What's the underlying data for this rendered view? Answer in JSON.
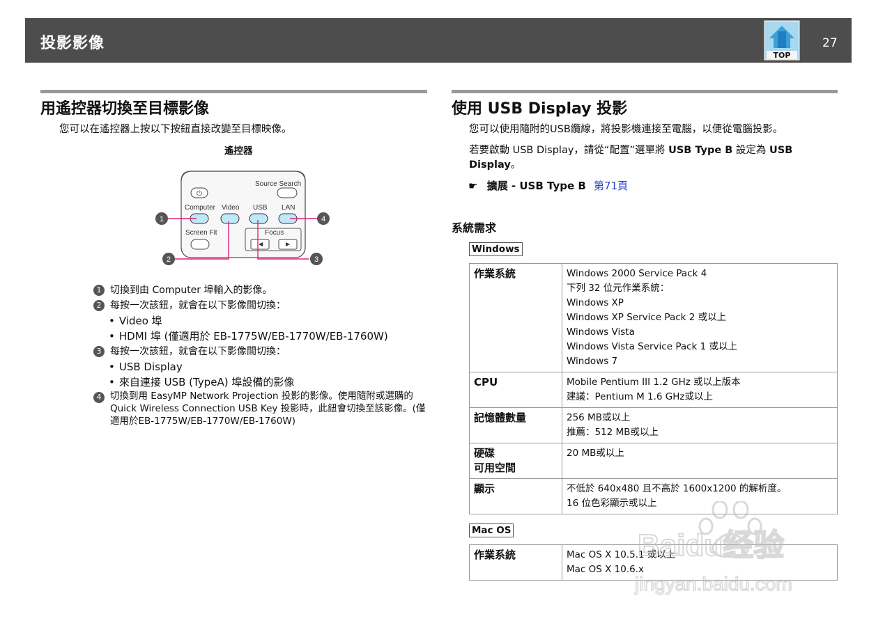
{
  "header": {
    "title": "投影影像",
    "page_number": "27",
    "top_label": "TOP"
  },
  "left": {
    "heading": "用遙控器切換至目標影像",
    "intro": "您可以在遙控器上按以下按鈕直接改變至目標映像。",
    "figure_title": "遙控器",
    "remote": {
      "source_search": "Source Search",
      "computer": "Computer",
      "video": "Video",
      "usb": "USB",
      "lan": "LAN",
      "screen_fit": "Screen Fit",
      "focus": "Focus",
      "callouts": [
        "1",
        "2",
        "3",
        "4"
      ]
    },
    "items": [
      {
        "num": "1",
        "text": "切換到由 Computer 埠輸入的影像。"
      },
      {
        "num": "2",
        "text": "每按一次該鈕，就會在以下影像間切換：",
        "bullets": [
          "Video 埠",
          "HDMI 埠 (僅適用於 EB-1775W/EB-1770W/EB-1760W)"
        ]
      },
      {
        "num": "3",
        "text": "每按一次該鈕，就會在以下影像間切換：",
        "bullets": [
          "USB Display",
          "來自連接 USB (TypeA) 埠設備的影像"
        ]
      },
      {
        "num": "4",
        "lines": [
          "切換到用 EasyMP Network Projection 投影的影像。使用隨附或選購的",
          "Quick Wireless Connection USB Key 投影時，此鈕會切換至該影像。(僅",
          "適用於EB-1775W/EB-1770W/EB-1760W)"
        ]
      }
    ]
  },
  "right": {
    "heading": "使用 USB Display 投影",
    "para1": "您可以使用隨附的USB纜線，將投影機連接至電腦，以便從電腦投影。",
    "para2_a": "若要啟動 USB Display，請從“配置”選單將 ",
    "para2_b": "USB Type B",
    "para2_c": " 設定為 ",
    "para2_d": "USB",
    "para2_e": "Display",
    "para2_f": "。",
    "ref_icon": "☛",
    "ref_text": "擴展 - USB Type B",
    "ref_link": "第71頁",
    "sys_heading": "系統需求",
    "windows_tag": "Windows",
    "windows_rows": [
      {
        "k": "作業系統",
        "v": [
          "Windows 2000 Service Pack 4",
          "下列 32 位元作業系統：",
          "Windows XP",
          "Windows XP Service Pack 2 或以上",
          "Windows Vista",
          "Windows Vista Service Pack 1 或以上",
          "Windows 7"
        ]
      },
      {
        "k": "CPU",
        "v": [
          "Mobile Pentium III 1.2 GHz 或以上版本",
          "建議：Pentium M 1.6 GHz或以上"
        ]
      },
      {
        "k": "記憶體數量",
        "v": [
          "256 MB或以上",
          "推薦：512 MB或以上"
        ]
      },
      {
        "k": "硬碟",
        "k2": "可用空間",
        "v": [
          "20 MB或以上"
        ]
      },
      {
        "k": "顯示",
        "v": [
          "不低於 640x480 且不高於 1600x1200 的解析度。",
          "16 位色彩顯示或以上"
        ]
      }
    ],
    "mac_tag": "Mac OS",
    "mac_rows": [
      {
        "k": "作業系統",
        "v": [
          "Mac OS X 10.5.1 或以上",
          "Mac OS X 10.6.x"
        ]
      }
    ]
  },
  "watermark": {
    "brand": "Baidu经验",
    "url": "jingyan.baidu.com"
  },
  "colors": {
    "header_bg": "#4d4d4d",
    "rule": "#999999",
    "button_fill": "#bfe8f8",
    "callout_line": "#e0207a",
    "link": "#2740c4"
  }
}
